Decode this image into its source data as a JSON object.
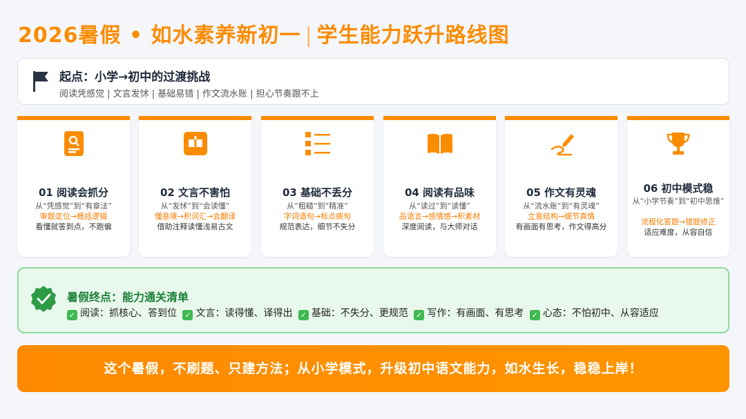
{
  "header": {
    "title_main": "2026暑假 • 如水素养新初一",
    "title_sep": "|",
    "title_sub": "学生能力跃升路线图"
  },
  "start": {
    "title": "起点：小学→初中的过渡挑战",
    "subtitle": "阅读凭感觉 | 文言发怵 | 基础易错 | 作文流水账 | 担心节奏跟不上"
  },
  "steps": [
    {
      "icon": "reading-doc-icon",
      "title": "01 阅读会抓分",
      "from_to": "从“凭感觉”到“有章法”",
      "methods": "审题定位→概括逻辑",
      "result": "看懂就答到点，不跑偏"
    },
    {
      "icon": "classical-text-icon",
      "title": "02 文言不害怕",
      "from_to": "从“发怵”到“会读懂”",
      "methods": "懂意境→积词汇→会翻译",
      "result": "借助注释读懂浅易古文"
    },
    {
      "icon": "list-icon",
      "title": "03 基础不丢分",
      "from_to": "从“粗糙”到“精准”",
      "methods": "字词语句→标点病句",
      "result": "规范表达，细节不失分"
    },
    {
      "icon": "open-book-icon",
      "title": "04 阅读有品味",
      "from_to": "从“读过”到“读懂”",
      "methods": "品语言→感情感→积素材",
      "result": "深度阅读，与大师对话"
    },
    {
      "icon": "pen-icon",
      "title": "05 作文有灵魂",
      "from_to": "从“流水账”到“有灵魂”",
      "methods": "立意结构→细节真情",
      "result": "有画面有思考，作文得高分"
    },
    {
      "icon": "trophy-icon",
      "title": "06 初中模式稳",
      "from_to": "从“小学节奏”到“初中思维”",
      "methods": "流程化答题→错题修正",
      "result": "适应难度，从容自信"
    }
  ],
  "end": {
    "title": "暑假终点：能力通关清单",
    "items": [
      "阅读：抓核心、答到位",
      "文言：读得懂、译得出",
      "基础：不失分、更规范",
      "写作：有画面、有思考",
      "心态：不怕初中、从容适应"
    ]
  },
  "banner": {
    "text": "这个暑假，不刷题、只建方法；从小学模式，升级初中语文能力，如水生长，稳稳上岸！"
  },
  "colors": {
    "accent": "#fb8c00",
    "success": "#3fb950",
    "success_bg": "#e9f8ec"
  }
}
